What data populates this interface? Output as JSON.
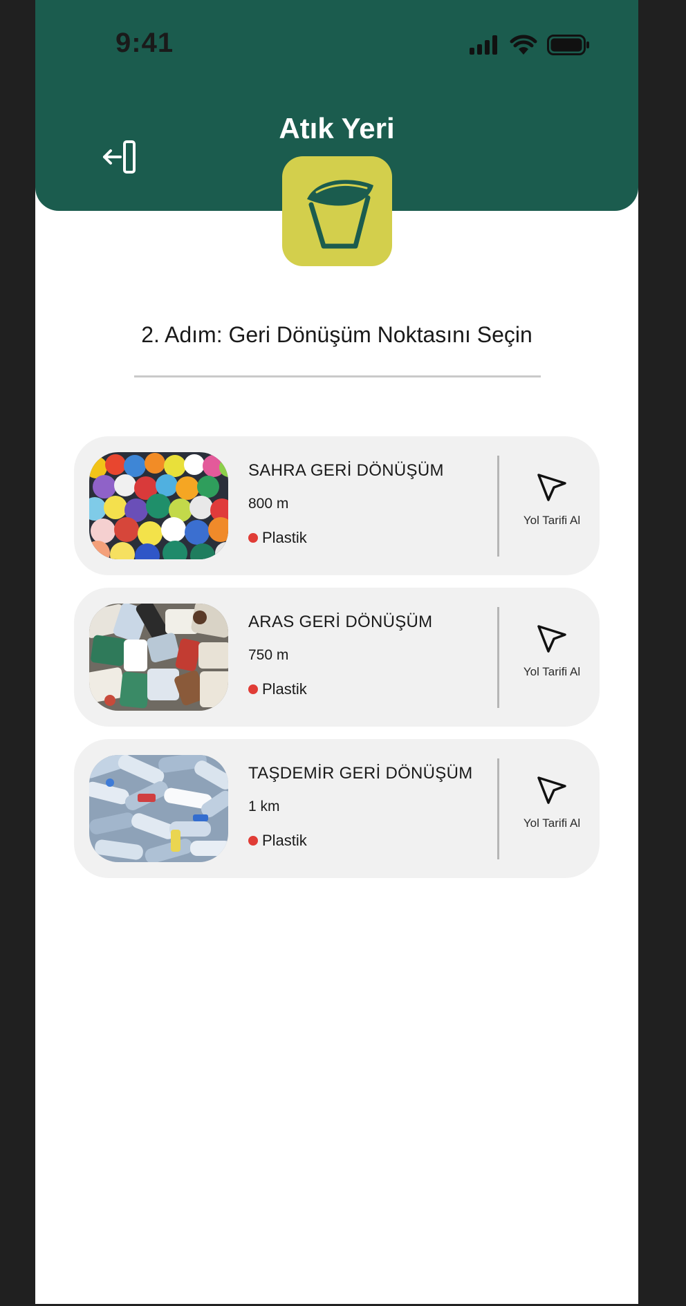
{
  "status_bar": {
    "time": "9:41"
  },
  "header": {
    "title": "Atık Yeri"
  },
  "icons": {
    "back": "exit-icon",
    "logo": "recycle-bin-leaf-icon",
    "route": "navigation-arrow-icon",
    "signal": "cellular-signal-icon",
    "wifi": "wifi-icon",
    "battery": "battery-icon"
  },
  "colors": {
    "header_bg": "#1b5c4e",
    "logo_bg": "#d3cf4c",
    "card_bg": "#f1f1f1",
    "category_dot": "#e03c36"
  },
  "step": {
    "title": "2. Adım: Geri Dönüşüm Noktasını Seçin"
  },
  "points": [
    {
      "name": "SAHRA GERİ DÖNÜŞÜM",
      "distance": "800 m",
      "category": "Plastik",
      "route_label": "Yol Tarifi Al",
      "image": "colorful-plastic-caps"
    },
    {
      "name": "ARAS GERİ DÖNÜŞÜM",
      "distance": "750 m",
      "category": "Plastik",
      "route_label": "Yol Tarifi Al",
      "image": "mixed-waste-pile"
    },
    {
      "name": "TAŞDEMİR GERİ DÖNÜŞÜM",
      "distance": "1 km",
      "category": "Plastik",
      "route_label": "Yol Tarifi Al",
      "image": "plastic-bottles-pile"
    }
  ]
}
